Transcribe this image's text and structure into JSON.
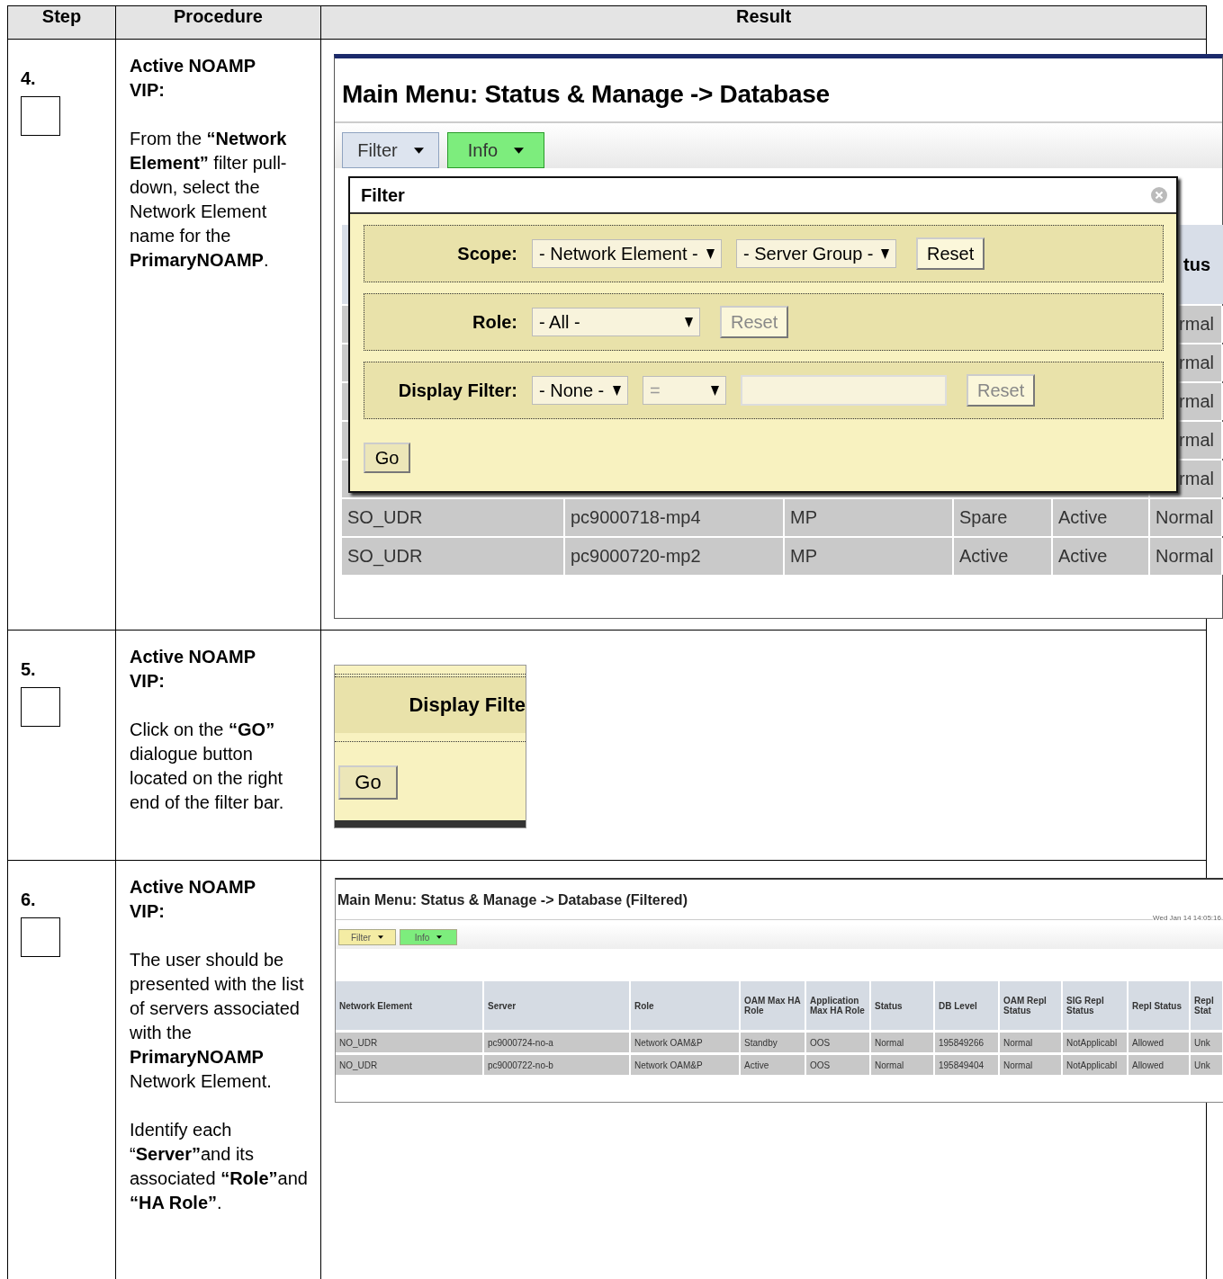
{
  "columns": [
    {
      "label": "Step"
    },
    {
      "label": "Procedure"
    },
    {
      "label": "Result"
    }
  ],
  "steps": [
    {
      "number": "4.",
      "checked": false,
      "heading": "Active NOAMP VIP:",
      "paragraphs": [
        "From the **“Network Element”** filter pull-down, select the Network Element name for the **PrimaryNOAMP**."
      ],
      "result": {
        "kind": "filter_dialog",
        "title": "Main Menu: Status & Manage -> Database",
        "buttons": [
          {
            "label": "Filter",
            "color": "#dde4ef"
          },
          {
            "label": "Info",
            "color": "#7ded7d"
          }
        ],
        "table_header_end": "tus",
        "rows": [
          [
            "rmal"
          ],
          [
            "rmal"
          ],
          [
            "rmal"
          ],
          [
            "rmal"
          ],
          [
            "rmal"
          ],
          [
            "SO_UDR",
            "pc9000718-mp4",
            "MP",
            "Spare",
            "Active",
            "Normal"
          ],
          [
            "SO_UDR",
            "pc9000720-mp2",
            "MP",
            "Active",
            "Active",
            "Normal"
          ]
        ],
        "dialog": {
          "title": "Filter",
          "go": "Go",
          "sections": [
            {
              "label": "Scope:",
              "selects": [
                "- Network Element -",
                "- Server Group -"
              ],
              "text_input": false,
              "reset": "Reset",
              "disabled": false
            },
            {
              "label": "Role:",
              "selects": [
                "- All -"
              ],
              "text_input": false,
              "reset": "Reset",
              "disabled": true
            },
            {
              "label": "Display Filter:",
              "selects": [
                "- None -",
                "="
              ],
              "text_input": true,
              "reset": "Reset",
              "disabled": true
            }
          ]
        }
      }
    },
    {
      "number": "5.",
      "checked": false,
      "heading": "Active NOAMP VIP:",
      "paragraphs": [
        "Click on the **“GO”** dialogue button located on the right end of the filter bar."
      ],
      "result": {
        "kind": "go_crop",
        "label": "Display Filte",
        "go": "Go"
      }
    },
    {
      "number": "6.",
      "checked": false,
      "heading": "Active NOAMP VIP:",
      "paragraphs": [
        "The user should be presented with the list of servers associated with the **PrimaryNOAMP** Network Element.",
        "Identify each “**Server”**and its associated **“Role”**and **“HA Role”**."
      ],
      "result": {
        "kind": "filtered_table",
        "title": "Main Menu: Status & Manage -> Database (Filtered)",
        "timestamp": "Wed Jan 14 14:05:16",
        "buttons": [
          {
            "label": "Filter",
            "color": "#f4eca4"
          },
          {
            "label": "Info",
            "color": "#7ded7d"
          }
        ],
        "columns": [
          "Network Element",
          "Server",
          "Role",
          "OAM Max HA Role",
          "Application Max HA Role",
          "Status",
          "DB Level",
          "OAM Repl Status",
          "SIG Repl Status",
          "Repl Status",
          "Repl Stat"
        ],
        "rows": [
          [
            "NO_UDR",
            "pc9000724-no-a",
            "Network OAM&P",
            "Standby",
            "OOS",
            "Normal",
            "195849266",
            "Normal",
            "NotApplicabl",
            "Allowed",
            "Unk"
          ],
          [
            "NO_UDR",
            "pc9000722-no-b",
            "Network OAM&P",
            "Active",
            "OOS",
            "Normal",
            "195849404",
            "Normal",
            "NotApplicabl",
            "Allowed",
            "Unk"
          ]
        ]
      }
    }
  ]
}
